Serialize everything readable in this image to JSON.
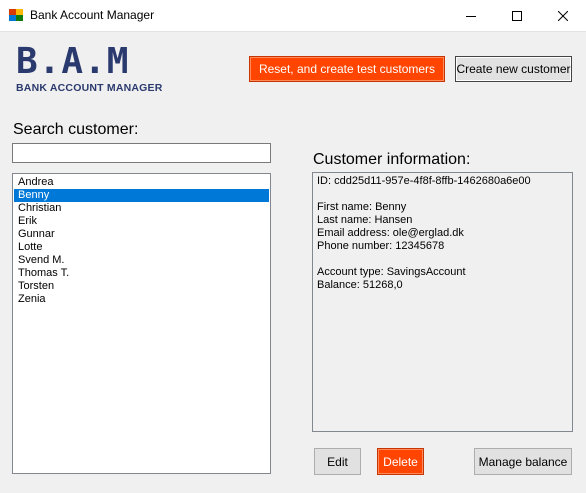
{
  "window": {
    "title": "Bank Account Manager",
    "minimize_label": "─",
    "maximize_label": "☐",
    "close_label": "✕"
  },
  "logo": {
    "big_text": "B.A.M",
    "sub_text": "BANK ACCOUNT MANAGER",
    "color": "#2b3a6e"
  },
  "toolbar": {
    "reset_label": "Reset, and create test customers",
    "create_label": "Create new customer"
  },
  "search": {
    "label": "Search customer:",
    "value": ""
  },
  "customers": {
    "items": [
      "Andrea",
      "Benny",
      "Christian",
      "Erik",
      "Gunnar",
      "Lotte",
      "Svend M.",
      "Thomas T.",
      "Torsten",
      "Zenia"
    ],
    "selected": "Benny"
  },
  "info": {
    "heading": "Customer information:",
    "id_line": "ID: cdd25d11-957e-4f8f-8ffb-1462680a6e00",
    "first_name_line": "First name: Benny",
    "last_name_line": "Last name: Hansen",
    "email_line": "Email address: ole@erglad.dk",
    "phone_line": "Phone number: 12345678",
    "account_type_line": "Account type: SavingsAccount",
    "balance_line": "Balance: 51268,0"
  },
  "actions": {
    "edit_label": "Edit",
    "delete_label": "Delete",
    "manage_label": "Manage balance"
  },
  "colors": {
    "accent_orange": "#ff4500",
    "selection_blue": "#0078d7"
  }
}
